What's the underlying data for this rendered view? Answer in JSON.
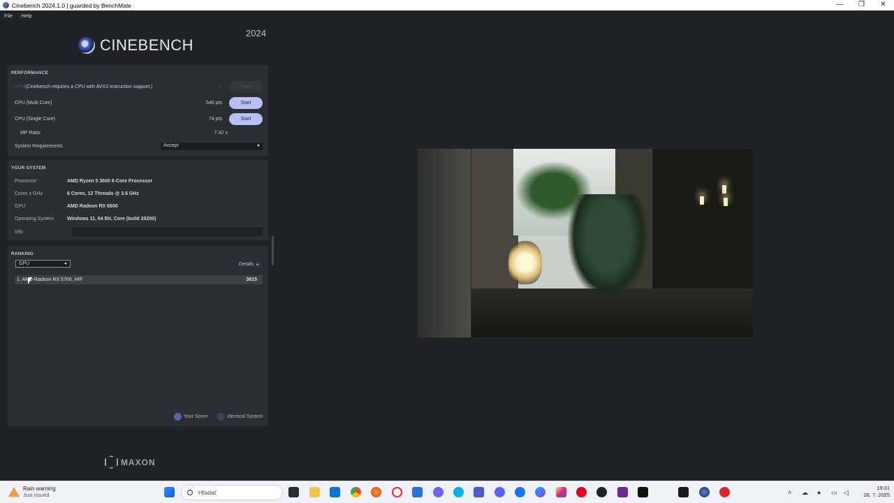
{
  "window": {
    "title": "Cinebench 2024.1.0 | guarded by BenchMate",
    "min_icon": "—",
    "max_icon": "❐",
    "close_icon": "✕"
  },
  "menu": {
    "file": "File",
    "help": "Help"
  },
  "brand": {
    "name": "CINEBENCH",
    "year": "2024",
    "footer": "MAXON"
  },
  "performance": {
    "title": "PERFORMANCE",
    "gpu_label": "GPU",
    "gpu_note": "(Cinebench requires a CPU with AVX2 instruction support.)",
    "gpu_score": "-",
    "gpu_button": "Start",
    "multi_label": "CPU (Multi Core)",
    "multi_score": "546 pts",
    "multi_button": "Start",
    "single_label": "CPU (Single Core)",
    "single_score": "74 pts",
    "single_button": "Start",
    "mp_label": "MP Ratio",
    "mp_value": "7.42 x",
    "sysreq_label": "System Requirements",
    "sysreq_value": "Accept"
  },
  "system": {
    "title": "YOUR SYSTEM",
    "rows": [
      {
        "label": "Processor",
        "value": "AMD Ryzen 5 3600 6-Core Processor"
      },
      {
        "label": "Cores x GHz",
        "value": "6 Cores, 12 Threads @ 3.6 GHz"
      },
      {
        "label": "GPU",
        "value": "AMD Radeon RX 6600"
      },
      {
        "label": "Operating System",
        "value": "Windows 11, 64 Bit, Core (build 26200)"
      }
    ],
    "info_label": "Info"
  },
  "ranking": {
    "title": "RANKING",
    "filter": "GPU",
    "details": "Details",
    "entries": [
      {
        "name": "1. AMD Radeon RX 5700, HIP",
        "score": "3615"
      }
    ],
    "legend_your": "Your Score",
    "legend_identical": "Identical System"
  },
  "taskbar": {
    "weather_title": "Rain warning",
    "weather_sub": "Just issued",
    "search_placeholder": "Hľadať",
    "time": "19:31",
    "date": "26. 7. 2025"
  },
  "colors": {
    "accent": "#b9bff5",
    "your_score": "#5a62a8",
    "identical": "#3c4160",
    "panel": "#2a2f33",
    "background": "#1f2326"
  }
}
